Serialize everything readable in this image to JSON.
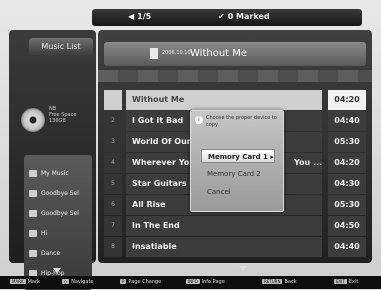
{
  "topbar": {
    "page_info": "1/5",
    "page_sym": "◀",
    "marked": "0 Marked",
    "marked_sym": "✔"
  },
  "sidebar": {
    "tab_label": "Music List",
    "info_lines": [
      "NB",
      "Free Space",
      "136GB"
    ],
    "menu": [
      {
        "label": "My Music"
      },
      {
        "label": "Goodbye Sel"
      },
      {
        "label": "Goodbye Sel"
      },
      {
        "label": "Hi"
      },
      {
        "label": "Dance"
      },
      {
        "label": "Hip-hop"
      }
    ]
  },
  "header": {
    "small": "2006.10.10",
    "title": "Without Me"
  },
  "tracks": [
    {
      "num": "",
      "title": "Without Me",
      "duration": "04:20",
      "selected": true
    },
    {
      "num": "2",
      "title": "I Got It Bad",
      "duration": "04:40"
    },
    {
      "num": "3",
      "title": "World Of Our",
      "duration": "05:30"
    },
    {
      "num": "4",
      "title": "Wherever You",
      "suffix": "You ...",
      "duration": "04:20"
    },
    {
      "num": "5",
      "title": "Star Guitars",
      "duration": "04:30"
    },
    {
      "num": "6",
      "title": "All Rise",
      "duration": "05:30"
    },
    {
      "num": "7",
      "title": "In The End",
      "duration": "04:50"
    },
    {
      "num": "8",
      "title": "Insatiable",
      "duration": "04:40"
    }
  ],
  "dialog": {
    "icon": "i",
    "message": "Choose the proper device to copy.",
    "options": [
      {
        "label": "Memory Card 1",
        "arrow": "▸",
        "selected": true
      },
      {
        "label": "Memory Card 2"
      },
      {
        "label": "Cancel"
      }
    ]
  },
  "bottombar": [
    {
      "key": "MARK",
      "label": "Mark"
    },
    {
      "key": "◇",
      "label": "Navigate"
    },
    {
      "key": "P",
      "label": "Page Change"
    },
    {
      "key": "INFO",
      "label": "Info Page"
    },
    {
      "key": "RETURN",
      "label": "Back"
    },
    {
      "key": "EXIT",
      "label": "Exit"
    }
  ]
}
